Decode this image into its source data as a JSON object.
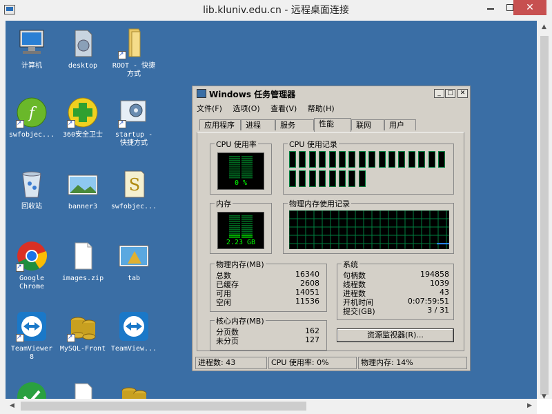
{
  "rdp": {
    "title": "lib.kluniv.edu.cn - 远程桌面连接"
  },
  "desktop": {
    "icons": [
      {
        "label": "计算机"
      },
      {
        "label": "desktop"
      },
      {
        "label": "ROOT - 快捷\n方式"
      },
      {
        "label": "swfobjec..."
      },
      {
        "label": "360安全卫士"
      },
      {
        "label": "startup -\n快捷方式"
      },
      {
        "label": "回收站"
      },
      {
        "label": "banner3"
      },
      {
        "label": "swfobjec..."
      },
      {
        "label": "Google\nChrome"
      },
      {
        "label": "images.zip"
      },
      {
        "label": "tab"
      },
      {
        "label": "TeamViewer\n8"
      },
      {
        "label": "MySQL-Front"
      },
      {
        "label": "TeamView..."
      }
    ]
  },
  "tm": {
    "title": "Windows 任务管理器",
    "menu": [
      "文件(F)",
      "选项(O)",
      "查看(V)",
      "帮助(H)"
    ],
    "tabs": [
      "应用程序",
      "进程",
      "服务",
      "性能",
      "联网",
      "用户"
    ],
    "cpu_usage_label": "CPU 使用率",
    "cpu_usage_value": "0 %",
    "cpu_history_label": "CPU 使用记录",
    "mem_label": "内存",
    "mem_value": "2.23 GB",
    "mem_history_label": "物理内存使用记录",
    "phys_mem": {
      "label": "物理内存(MB)",
      "rows": [
        {
          "k": "总数",
          "v": "16340"
        },
        {
          "k": "已缓存",
          "v": "2608"
        },
        {
          "k": "可用",
          "v": "14051"
        },
        {
          "k": "空闲",
          "v": "11536"
        }
      ]
    },
    "kernel_mem": {
      "label": "核心内存(MB)",
      "rows": [
        {
          "k": "分页数",
          "v": "162"
        },
        {
          "k": "未分页",
          "v": "127"
        }
      ]
    },
    "system": {
      "label": "系统",
      "rows": [
        {
          "k": "句柄数",
          "v": "194858"
        },
        {
          "k": "线程数",
          "v": "1039"
        },
        {
          "k": "进程数",
          "v": "43"
        },
        {
          "k": "开机时间",
          "v": "0:07:59:51"
        },
        {
          "k": "提交(GB)",
          "v": "3 / 31"
        }
      ]
    },
    "resource_monitor_button": "资源监视器(R)...",
    "status": {
      "processes": "进程数: 43",
      "cpu": "CPU 使用率: 0%",
      "memory": "物理内存: 14%"
    },
    "cpu_cores": 16,
    "mem_usage_fraction": 0.14
  },
  "colors": {
    "desktop": "#3a6ea5",
    "meter_green": "#00ff00",
    "graph_grid": "#008040"
  }
}
